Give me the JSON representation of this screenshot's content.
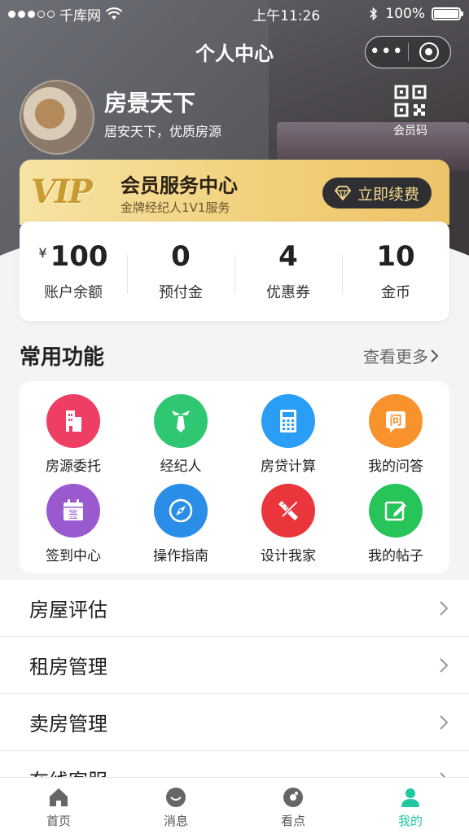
{
  "status_bar": {
    "carrier": "千库网",
    "time": "上午11:26",
    "battery": "100%"
  },
  "nav": {
    "title": "个人中心",
    "more_label": "•••"
  },
  "profile": {
    "name": "房景天下",
    "tagline": "居安天下，优质房源",
    "qr_label": "会员码"
  },
  "vip": {
    "logo": "VIP",
    "title": "会员服务中心",
    "subtitle": "金牌经纪人1V1服务",
    "renew_label": "立即续费"
  },
  "stats": [
    {
      "currency": "¥",
      "value": "100",
      "label": "账户余额"
    },
    {
      "currency": "",
      "value": "0",
      "label": "预付金"
    },
    {
      "currency": "",
      "value": "4",
      "label": "优惠券"
    },
    {
      "currency": "",
      "value": "10",
      "label": "金币"
    }
  ],
  "functions": {
    "title": "常用功能",
    "more": "查看更多",
    "items": [
      {
        "label": "房源委托",
        "icon": "building-icon",
        "color": "#ef3e64"
      },
      {
        "label": "经纪人",
        "icon": "tie-icon",
        "color": "#2fc772"
      },
      {
        "label": "房贷计算",
        "icon": "calculator-icon",
        "color": "#2a9df4"
      },
      {
        "label": "我的问答",
        "icon": "question-icon",
        "color": "#f7922c",
        "glyph": "问"
      },
      {
        "label": "签到中心",
        "icon": "calendar-sign-icon",
        "color": "#9b59d0",
        "glyph": "签"
      },
      {
        "label": "操作指南",
        "icon": "compass-icon",
        "color": "#2a8ee8"
      },
      {
        "label": "设计我家",
        "icon": "design-tools-icon",
        "color": "#e9353b"
      },
      {
        "label": "我的帖子",
        "icon": "edit-icon",
        "color": "#27c45a"
      }
    ]
  },
  "menu": [
    {
      "label": "房屋评估"
    },
    {
      "label": "租房管理"
    },
    {
      "label": "卖房管理"
    },
    {
      "label": "在线客服"
    }
  ],
  "tabs": [
    {
      "label": "首页",
      "icon": "home-icon"
    },
    {
      "label": "消息",
      "icon": "message-icon"
    },
    {
      "label": "看点",
      "icon": "discover-icon"
    },
    {
      "label": "我的",
      "icon": "user-icon",
      "active": true
    }
  ]
}
